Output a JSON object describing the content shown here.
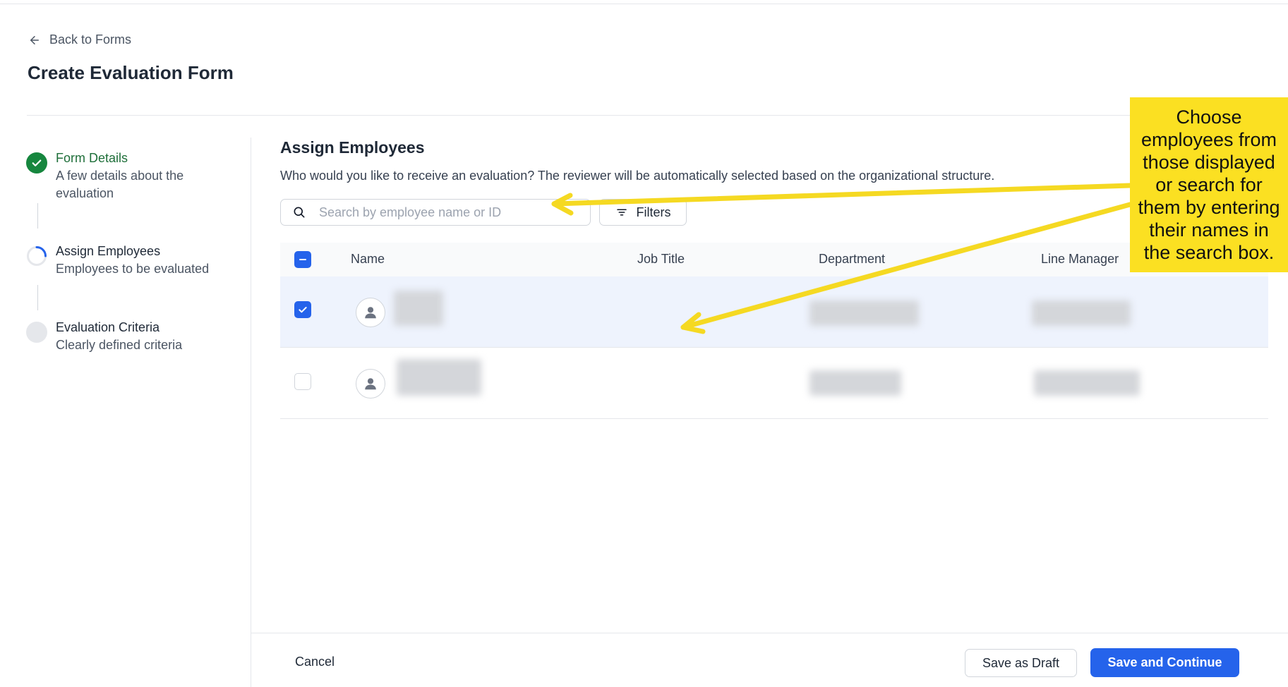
{
  "header": {
    "back_label": "Back to Forms",
    "title": "Create Evaluation Form"
  },
  "stepper": {
    "steps": [
      {
        "title": "Form Details",
        "subtitle": "A few details about the evaluation",
        "state": "completed"
      },
      {
        "title": "Assign Employees",
        "subtitle": "Employees to be evaluated",
        "state": "in-progress"
      },
      {
        "title": "Evaluation Criteria",
        "subtitle": "Clearly defined criteria",
        "state": "pending"
      }
    ]
  },
  "main": {
    "section_title": "Assign Employees",
    "description": "Who would you like to receive an evaluation? The reviewer will be automatically selected based on the organizational structure.",
    "search": {
      "placeholder": "Search by employee name or ID",
      "value": ""
    },
    "filters_label": "Filters",
    "table": {
      "columns": [
        "Name",
        "Job Title",
        "Department",
        "Line Manager"
      ],
      "header_checkbox_state": "indeterminate",
      "rows": [
        {
          "checked": true,
          "name": "",
          "job_title": "",
          "department": "",
          "line_manager": ""
        },
        {
          "checked": false,
          "name": "",
          "job_title": "",
          "department": "",
          "line_manager": ""
        }
      ]
    }
  },
  "footer": {
    "cancel_label": "Cancel",
    "draft_label": "Save as Draft",
    "continue_label": "Save and Continue"
  },
  "annotation": {
    "text": "Choose employees from those displayed or search for them by entering their names in the search box."
  },
  "colors": {
    "primary": "#2563eb",
    "success": "#16863e",
    "selected_row": "#eef3fd",
    "callout": "#fbe022"
  }
}
